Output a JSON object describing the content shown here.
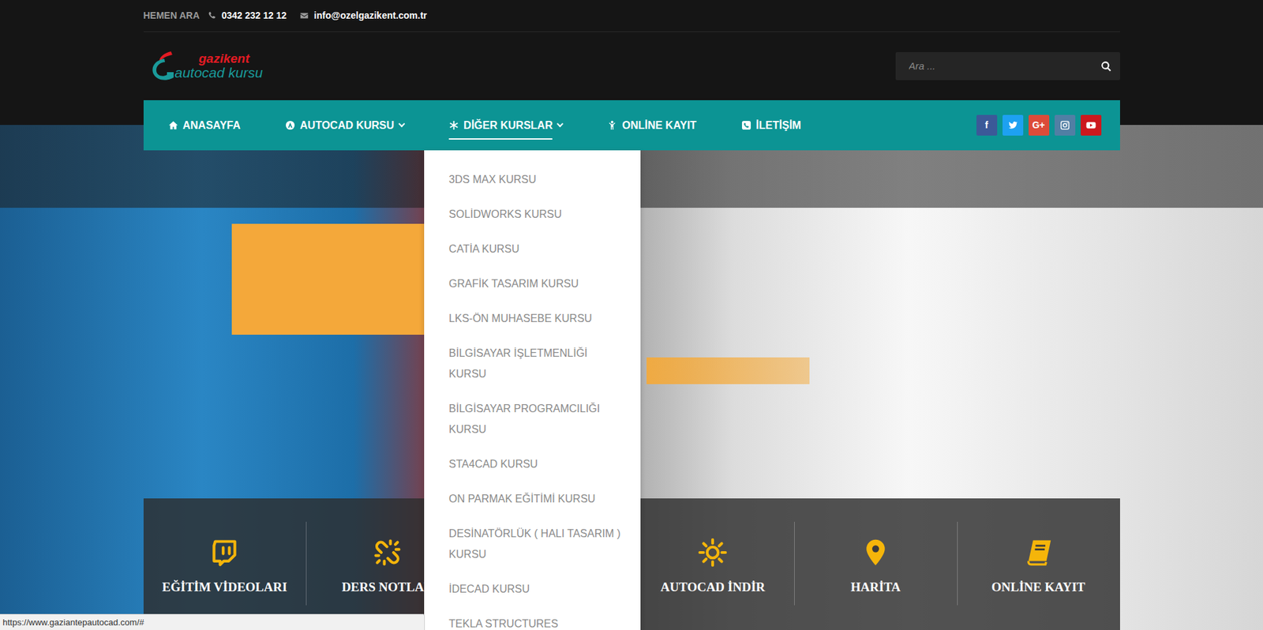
{
  "topbar": {
    "call_label": "HEMEN ARA",
    "phone": "0342 232 12 12",
    "email": "info@ozelgazikent.com.tr"
  },
  "logo": {
    "line1": "gazikent",
    "line2": "autocad kursu"
  },
  "search": {
    "placeholder": "Ara ..."
  },
  "nav": [
    {
      "label": "ANASAYFA",
      "kind": "link",
      "selected": false,
      "expanded": false
    },
    {
      "label": "AUTOCAD KURSU",
      "kind": "menu",
      "selected": false,
      "expanded": false
    },
    {
      "label": "DİĞER KURSLAR",
      "kind": "menu",
      "selected": true,
      "expanded": true
    },
    {
      "label": "ONLİNE KAYIT",
      "kind": "link",
      "selected": false,
      "expanded": false
    },
    {
      "label": "İLETİŞİM",
      "kind": "link",
      "selected": false,
      "expanded": false
    }
  ],
  "dropdown": {
    "items": [
      "3DS MAX KURSU",
      "SOLİDWORKS KURSU",
      "CATİA KURSU",
      "GRAFİK TASARIM KURSU",
      "LKS-ÖN MUHASEBE KURSU",
      "BİLGİSAYAR İŞLETMENLİĞİ KURSU",
      "BİLGİSAYAR PROGRAMCILIĞI KURSU",
      "STA4CAD KURSU",
      "ON PARMAK EĞİTİMİ KURSU",
      "DESİNATÖRLÜK ( HALI TASARIM ) KURSU",
      "İDECAD KURSU",
      "TEKLA STRUCTURES"
    ]
  },
  "social": [
    {
      "glyph": "f",
      "color": "#3b5998"
    },
    {
      "color": "#1da1f2"
    },
    {
      "glyph": "G+",
      "color": "#dd4b39"
    },
    {
      "color": "#517fa4"
    },
    {
      "color": "#cc181e"
    }
  ],
  "features": [
    {
      "label": "EĞİTİM VİDEOLARI"
    },
    {
      "label": "DERS NOTLAR"
    },
    {
      "label": "AUTOCAD İNDİR"
    },
    {
      "label": "HARİTA"
    },
    {
      "label": "ONLİNE KAYIT"
    }
  ],
  "status_bar": {
    "url": "https://www.gaziantepautocad.com/#"
  }
}
